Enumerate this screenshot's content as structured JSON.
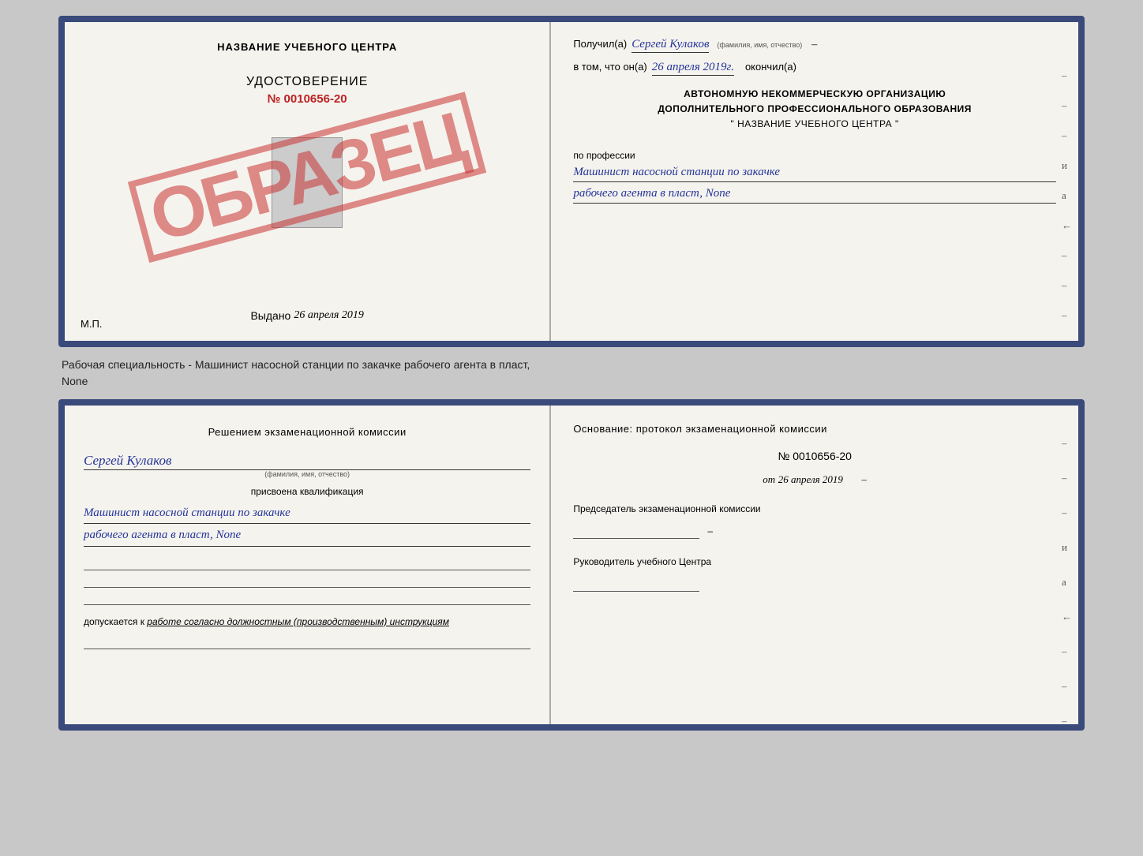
{
  "page": {
    "background": "#c8c8c8"
  },
  "top_cert": {
    "left": {
      "title": "НАЗВАНИЕ УЧЕБНОГО ЦЕНТРА",
      "stamp": "ОБРАЗЕЦ",
      "doc_label": "УДОСТОВЕРЕНИЕ",
      "doc_number": "№ 0010656-20",
      "vydano_label": "Выдано",
      "vydano_date": "26 апреля 2019",
      "mp": "М.П."
    },
    "right": {
      "poluchil_label": "Получил(а)",
      "poluchil_value": "Сергей Кулаков",
      "poluchil_sub": "(фамилия, имя, отчество)",
      "vtom_label": "в том, что он(а)",
      "vtom_date": "26 апреля 2019г.",
      "okonchil_label": "окончил(а)",
      "org_line1": "АВТОНОМНУЮ НЕКОММЕРЧЕСКУЮ ОРГАНИЗАЦИЮ",
      "org_line2": "ДОПОЛНИТЕЛЬНОГО ПРОФЕССИОНАЛЬНОГО ОБРАЗОВАНИЯ",
      "org_line3": "\"  НАЗВАНИЕ УЧЕБНОГО ЦЕНТРА  \"",
      "profession_label": "по профессии",
      "profession_line1": "Машинист насосной станции по закачке",
      "profession_line2": "рабочего агента в пласт, None",
      "side_dashes": [
        "-",
        "-",
        "-",
        "и",
        "а",
        "←",
        "-",
        "-",
        "-"
      ]
    }
  },
  "description": {
    "line1": "Рабочая специальность - Машинист насосной станции по закачке рабочего агента в пласт,",
    "line2": "None"
  },
  "bottom_cert": {
    "left": {
      "commission_text": "Решением экзаменационной комиссии",
      "name_value": "Сергей Кулаков",
      "name_sub": "(фамилия, имя, отчество)",
      "assigned_label": "присвоена квалификация",
      "profession_line1": "Машинист насосной станции по закачке",
      "profession_line2": "рабочего агента в пласт, None",
      "dopuskaetsya_label": "допускается к",
      "dopuskaetsya_italic": "работе согласно должностным (производственным) инструкциям"
    },
    "right": {
      "osnov_text": "Основание: протокол экзаменационной комиссии",
      "number_label": "№ 0010656-20",
      "date_prefix": "от",
      "date_value": "26 апреля 2019",
      "predsedatel_label": "Председатель экзаменационной комиссии",
      "rukovoditel_label": "Руководитель учебного Центра",
      "side_dashes": [
        "-",
        "-",
        "-",
        "и",
        "а",
        "←",
        "-",
        "-",
        "-"
      ]
    }
  }
}
